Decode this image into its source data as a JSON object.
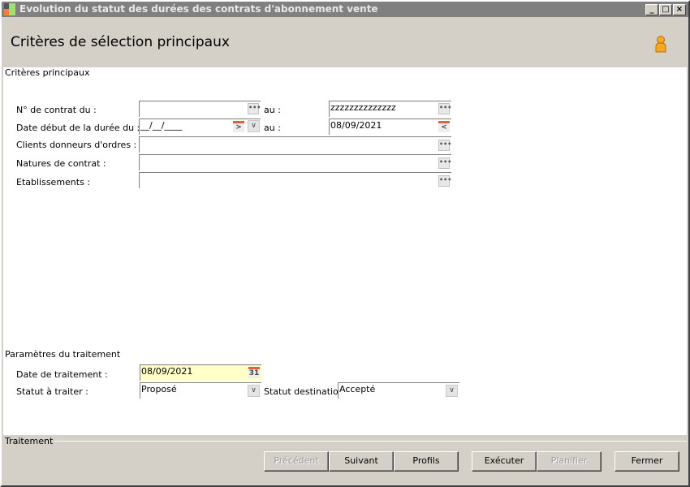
{
  "window": {
    "title": "Evolution du statut des durées des contrats d'abonnement vente",
    "minimize": "_",
    "maximize": "□",
    "close": "×"
  },
  "header": {
    "title": "Critères de sélection principaux"
  },
  "main_criteria": {
    "group_label": "Critères principaux",
    "contract_from_label": "N° de contrat du :",
    "contract_from_value": "",
    "contract_to_label": "au :",
    "contract_to_value": "zzzzzzzzzzzzzz",
    "start_date_label": "Date début de la durée du :",
    "start_date_value": "__/__/____",
    "start_date_to_label": "au :",
    "start_date_to_value": "08/09/2021",
    "clients_label": "Clients donneurs d'ordres :",
    "clients_value": "",
    "natures_label": "Natures de contrat :",
    "natures_value": "",
    "etablissements_label": "Etablissements :",
    "etablissements_value": "",
    "ellipsis": "•••"
  },
  "processing": {
    "group_label": "Paramètres du traitement",
    "date_label": "Date de traitement :",
    "date_value": "08/09/2021",
    "calendar_day": "31",
    "status_label": "Statut à traiter :",
    "status_value": "Proposé",
    "dest_label": "Statut destination :",
    "dest_value": "Accepté"
  },
  "footer": {
    "group_label": "Traitement",
    "buttons": {
      "previous": "Précédent",
      "next": "Suivant",
      "profiles": "Profils",
      "execute": "Exécuter",
      "schedule": "Planifier",
      "close": "Fermer"
    }
  }
}
